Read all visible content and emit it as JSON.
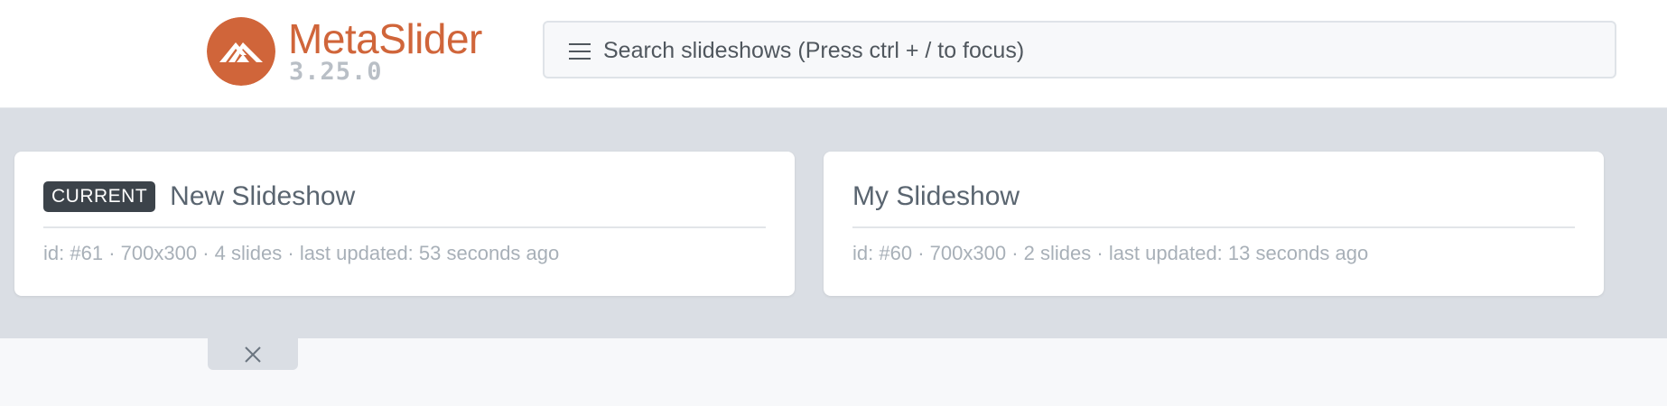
{
  "header": {
    "brand_part1": "Meta",
    "brand_part2": "Slider",
    "version": "3.25.0",
    "search": {
      "placeholder": "Search slideshows (Press ctrl + / to focus)",
      "icon": "menu-icon"
    }
  },
  "slideshows": [
    {
      "badge": "CURRENT",
      "title": "New Slideshow",
      "id": "id: #61",
      "size": "700x300",
      "slides": "4 slides",
      "updated": "last updated: 53 seconds ago"
    },
    {
      "badge": "",
      "title": "My Slideshow",
      "id": "id: #60",
      "size": "700x300",
      "slides": "2 slides",
      "updated": "last updated: 13 seconds ago"
    }
  ],
  "separator": "·",
  "close_icon": "close-icon",
  "colors": {
    "brand": "#d0653a",
    "badge_bg": "#3c434a",
    "band_bg": "#dadee4"
  }
}
